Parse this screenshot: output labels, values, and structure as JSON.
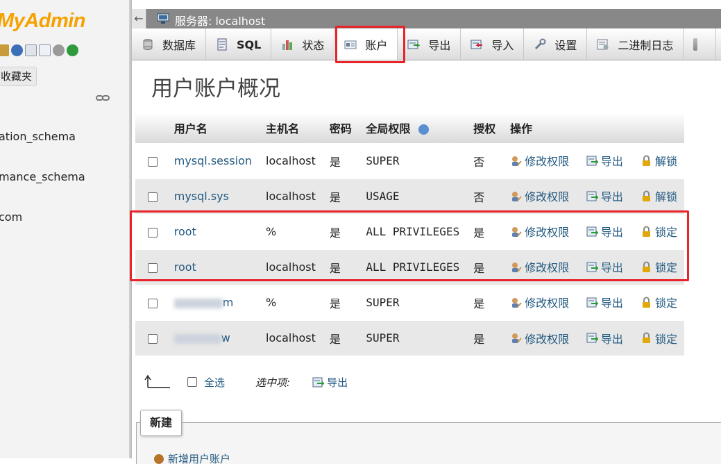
{
  "sidebar": {
    "logo": "MyAdmin",
    "favorites_label": "收藏夹",
    "databases": [
      "ation_schema",
      "mance_schema",
      "com"
    ]
  },
  "topbar": {
    "server_label": "服务器:  localhost"
  },
  "tabs": [
    {
      "label": "数据库",
      "icon": "database-icon"
    },
    {
      "label": "SQL",
      "icon": "sql-icon"
    },
    {
      "label": "状态",
      "icon": "status-icon"
    },
    {
      "label": "账户",
      "icon": "accounts-icon",
      "active": true
    },
    {
      "label": "导出",
      "icon": "export-icon"
    },
    {
      "label": "导入",
      "icon": "import-icon"
    },
    {
      "label": "设置",
      "icon": "settings-icon"
    },
    {
      "label": "二进制日志",
      "icon": "binlog-icon"
    }
  ],
  "page_title": "用户账户概况",
  "table": {
    "headers": [
      "用户名",
      "主机名",
      "密码",
      "全局权限",
      "授权",
      "操作"
    ],
    "rows": [
      {
        "user": "mysql.session",
        "host": "localhost",
        "password": "是",
        "privileges": "SUPER",
        "grant": "否",
        "edit": "修改权限",
        "export": "导出",
        "lock": "解锁"
      },
      {
        "user": "mysql.sys",
        "host": "localhost",
        "password": "是",
        "privileges": "USAGE",
        "grant": "否",
        "edit": "修改权限",
        "export": "导出",
        "lock": "解锁"
      },
      {
        "user": "root",
        "host": "%",
        "password": "是",
        "privileges": "ALL PRIVILEGES",
        "grant": "是",
        "edit": "修改权限",
        "export": "导出",
        "lock": "锁定"
      },
      {
        "user": "root",
        "host": "localhost",
        "password": "是",
        "privileges": "ALL PRIVILEGES",
        "grant": "是",
        "edit": "修改权限",
        "export": "导出",
        "lock": "锁定"
      },
      {
        "user": "m",
        "host": "%",
        "password": "是",
        "privileges": "SUPER",
        "grant": "是",
        "edit": "修改权限",
        "export": "导出",
        "lock": "锁定"
      },
      {
        "user": "w",
        "host": "localhost",
        "password": "是",
        "privileges": "SUPER",
        "grant": "是",
        "edit": "修改权限",
        "export": "导出",
        "lock": "锁定"
      }
    ]
  },
  "bulk": {
    "select_all": "全选",
    "with_selected": "选中项:",
    "export": "导出"
  },
  "new_section": {
    "legend": "新建",
    "add_user": "新增用户账户"
  },
  "colors": {
    "highlight": "#e8242a",
    "link": "#235a81",
    "logo": "#f5a200"
  }
}
